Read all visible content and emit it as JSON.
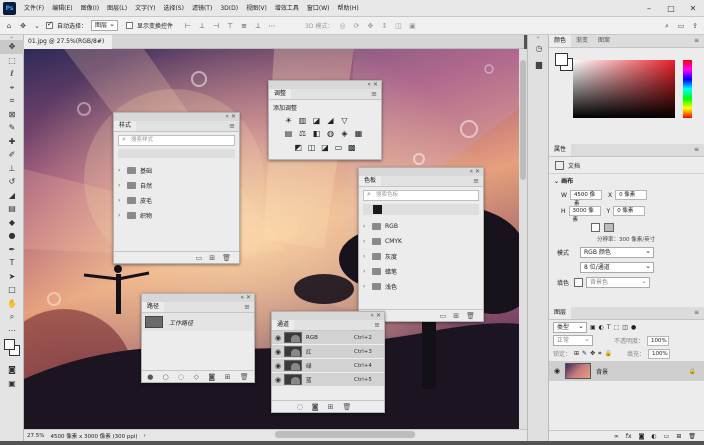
{
  "menubar": {
    "logo": "Ps",
    "items": [
      "文件(F)",
      "编辑(E)",
      "图像(I)",
      "图层(L)",
      "文字(Y)",
      "选择(S)",
      "滤镜(T)",
      "3D(D)",
      "视图(V)",
      "增效工具",
      "窗口(W)",
      "帮助(H)"
    ]
  },
  "options": {
    "auto_select_label": "自动选择：",
    "auto_select_value": "图层",
    "show_transform_label": "显示变换控件",
    "mode_3d_label": "3D 模式："
  },
  "document": {
    "tab_title": "01.jpg @ 27.5%(RGB/8#) *",
    "zoom": "27.5%",
    "size_info": "4500 像素 x 3000 像素 (300 ppi)"
  },
  "styles_panel": {
    "tab": "样式",
    "search_placeholder": "搜索样式",
    "folders": [
      "基础",
      "自然",
      "皮毛",
      "织物"
    ]
  },
  "adjustments_panel": {
    "tab": "调整",
    "add_label": "添加调整",
    "icons": [
      "☀",
      "▥",
      "◪",
      "◢",
      "▽",
      "▤",
      "⚖",
      "◧",
      "◍",
      "◈",
      "▦",
      "◩",
      "◫",
      "◪",
      "▭",
      "▩"
    ]
  },
  "swatches_panel": {
    "tab": "色板",
    "search_placeholder": "搜索色板",
    "folders": [
      "RGB",
      "CMYK",
      "灰度",
      "蜡笔",
      "浅色"
    ]
  },
  "paths_panel": {
    "tab": "路径",
    "work_path": "工作路径"
  },
  "channels_panel": {
    "tab": "通道",
    "channels": [
      {
        "name": "RGB",
        "shortcut": "Ctrl+2"
      },
      {
        "name": "红",
        "shortcut": "Ctrl+3"
      },
      {
        "name": "绿",
        "shortcut": "Ctrl+4"
      },
      {
        "name": "蓝",
        "shortcut": "Ctrl+5"
      }
    ]
  },
  "color_panel": {
    "tabs": [
      "颜色",
      "渐变",
      "图案"
    ],
    "hue_color": "#e8202a"
  },
  "properties_panel": {
    "tab": "属性",
    "doc_label": "文档",
    "canvas_label": "画布",
    "w_label": "W",
    "w_value": "4500 像素",
    "h_label": "H",
    "h_value": "3000 像素",
    "x_label": "X",
    "x_value": "0 像素",
    "y_label": "Y",
    "y_value": "0 像素",
    "resolution": "分辨率：300 像素/英寸",
    "mode_label": "模式",
    "mode_value": "RGB 颜色",
    "depth_value": "8 位/通道",
    "fill_label": "填色",
    "fill_value": "背景色"
  },
  "layers_panel": {
    "tab": "图层",
    "kind_filter": "类型",
    "blend_mode": "正常",
    "opacity_label": "不透明度：",
    "opacity_value": "100%",
    "lock_label": "锁定：",
    "fill_label": "填充：",
    "fill_value": "100%",
    "layer_name": "背景"
  }
}
